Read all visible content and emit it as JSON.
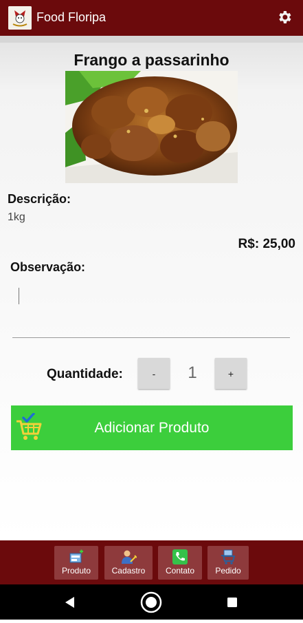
{
  "app_bar": {
    "title": "Food Floripa",
    "logo_icon": "food-floripa-logo",
    "settings_icon": "gear-icon"
  },
  "product": {
    "title": "Frango a passarinho",
    "image_icon": "fried-chicken-photo",
    "description_label": "Descrição:",
    "description_value": "1kg",
    "price": "R$: 25,00"
  },
  "observation": {
    "label": "Observação:",
    "value": ""
  },
  "quantity": {
    "label": "Quantidade:",
    "minus_label": "-",
    "value": "1",
    "plus_label": "+"
  },
  "add_button": {
    "label": "Adicionar Produto",
    "icon": "shopping-cart-check-icon"
  },
  "bottom_nav": {
    "items": [
      {
        "label": "Produto",
        "icon": "product-icon"
      },
      {
        "label": "Cadastro",
        "icon": "user-register-icon"
      },
      {
        "label": "Contato",
        "icon": "phone-icon"
      },
      {
        "label": "Pedido",
        "icon": "order-cart-icon"
      }
    ]
  },
  "system_nav": {
    "back_icon": "back-triangle-icon",
    "home_icon": "home-circle-icon",
    "recents_icon": "recents-square-icon"
  },
  "colors": {
    "app_bar": "#6b0a0c",
    "tab_background": "#8e3a3c",
    "add_button": "#3cce3c",
    "quantity_button": "#d9d9d9"
  }
}
